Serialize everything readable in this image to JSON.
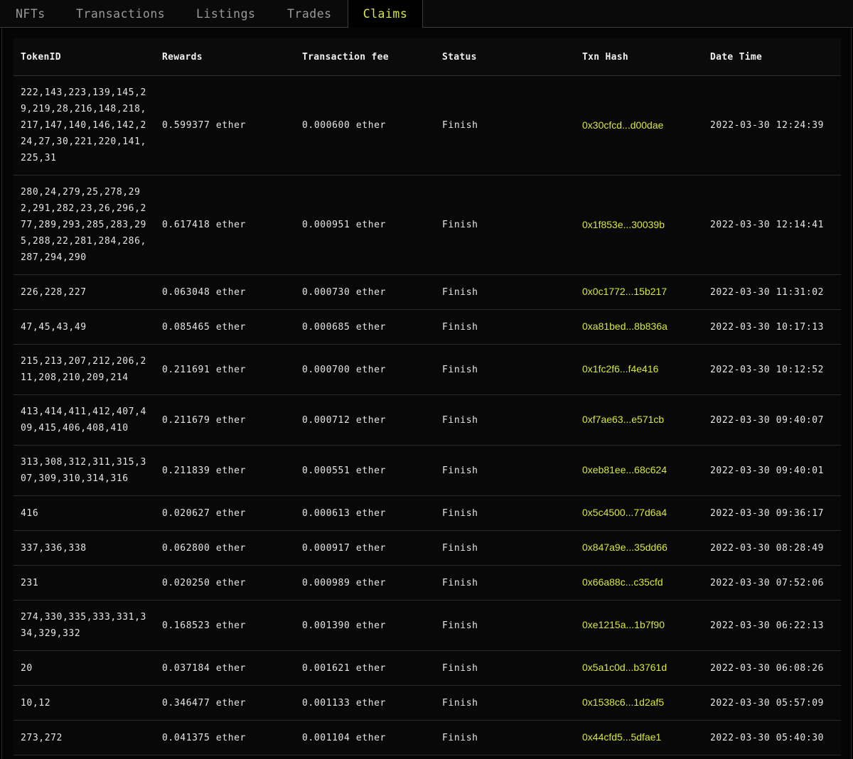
{
  "tabs": [
    {
      "label": "NFTs"
    },
    {
      "label": "Transactions"
    },
    {
      "label": "Listings"
    },
    {
      "label": "Trades"
    },
    {
      "label": "Claims"
    }
  ],
  "active_tab": "Claims",
  "accent_color": "#d7e83a",
  "table": {
    "headers": {
      "token_id": "TokenID",
      "rewards": "Rewards",
      "fee": "Transaction fee",
      "status": "Status",
      "hash": "Txn Hash",
      "datetime": "Date Time"
    },
    "rows": [
      {
        "token_id": "222,143,223,139,145,29,219,28,216,148,218,217,147,140,146,142,224,27,30,221,220,141,225,31",
        "rewards": "0.599377 ether",
        "fee": "0.000600 ether",
        "status": "Finish",
        "hash": "0x30cfcd...d00dae",
        "datetime": "2022-03-30 12:24:39"
      },
      {
        "token_id": "280,24,279,25,278,292,291,282,23,26,296,277,289,293,285,283,295,288,22,281,284,286,287,294,290",
        "rewards": "0.617418 ether",
        "fee": "0.000951 ether",
        "status": "Finish",
        "hash": "0x1f853e...30039b",
        "datetime": "2022-03-30 12:14:41"
      },
      {
        "token_id": "226,228,227",
        "rewards": "0.063048 ether",
        "fee": "0.000730 ether",
        "status": "Finish",
        "hash": "0x0c1772...15b217",
        "datetime": "2022-03-30 11:31:02"
      },
      {
        "token_id": "47,45,43,49",
        "rewards": "0.085465 ether",
        "fee": "0.000685 ether",
        "status": "Finish",
        "hash": "0xa81bed...8b836a",
        "datetime": "2022-03-30 10:17:13"
      },
      {
        "token_id": "215,213,207,212,206,211,208,210,209,214",
        "rewards": "0.211691 ether",
        "fee": "0.000700 ether",
        "status": "Finish",
        "hash": "0x1fc2f6...f4e416",
        "datetime": "2022-03-30 10:12:52"
      },
      {
        "token_id": "413,414,411,412,407,409,415,406,408,410",
        "rewards": "0.211679 ether",
        "fee": "0.000712 ether",
        "status": "Finish",
        "hash": "0xf7ae63...e571cb",
        "datetime": "2022-03-30 09:40:07"
      },
      {
        "token_id": "313,308,312,311,315,307,309,310,314,316",
        "rewards": "0.211839 ether",
        "fee": "0.000551 ether",
        "status": "Finish",
        "hash": "0xeb81ee...68c624",
        "datetime": "2022-03-30 09:40:01"
      },
      {
        "token_id": "416",
        "rewards": "0.020627 ether",
        "fee": "0.000613 ether",
        "status": "Finish",
        "hash": "0x5c4500...77d6a4",
        "datetime": "2022-03-30 09:36:17"
      },
      {
        "token_id": "337,336,338",
        "rewards": "0.062800 ether",
        "fee": "0.000917 ether",
        "status": "Finish",
        "hash": "0x847a9e...35dd66",
        "datetime": "2022-03-30 08:28:49"
      },
      {
        "token_id": "231",
        "rewards": "0.020250 ether",
        "fee": "0.000989 ether",
        "status": "Finish",
        "hash": "0x66a88c...c35cfd",
        "datetime": "2022-03-30 07:52:06"
      },
      {
        "token_id": "274,330,335,333,331,334,329,332",
        "rewards": "0.168523 ether",
        "fee": "0.001390 ether",
        "status": "Finish",
        "hash": "0xe1215a...1b7f90",
        "datetime": "2022-03-30 06:22:13"
      },
      {
        "token_id": "20",
        "rewards": "0.037184 ether",
        "fee": "0.001621 ether",
        "status": "Finish",
        "hash": "0x5a1c0d...b3761d",
        "datetime": "2022-03-30 06:08:26"
      },
      {
        "token_id": "10,12",
        "rewards": "0.346477 ether",
        "fee": "0.001133 ether",
        "status": "Finish",
        "hash": "0x1538c6...1d2af5",
        "datetime": "2022-03-30 05:57:09"
      },
      {
        "token_id": "273,272",
        "rewards": "0.041375 ether",
        "fee": "0.001104 ether",
        "status": "Finish",
        "hash": "0x44cfd5...5dfae1",
        "datetime": "2022-03-30 05:40:30"
      }
    ]
  }
}
